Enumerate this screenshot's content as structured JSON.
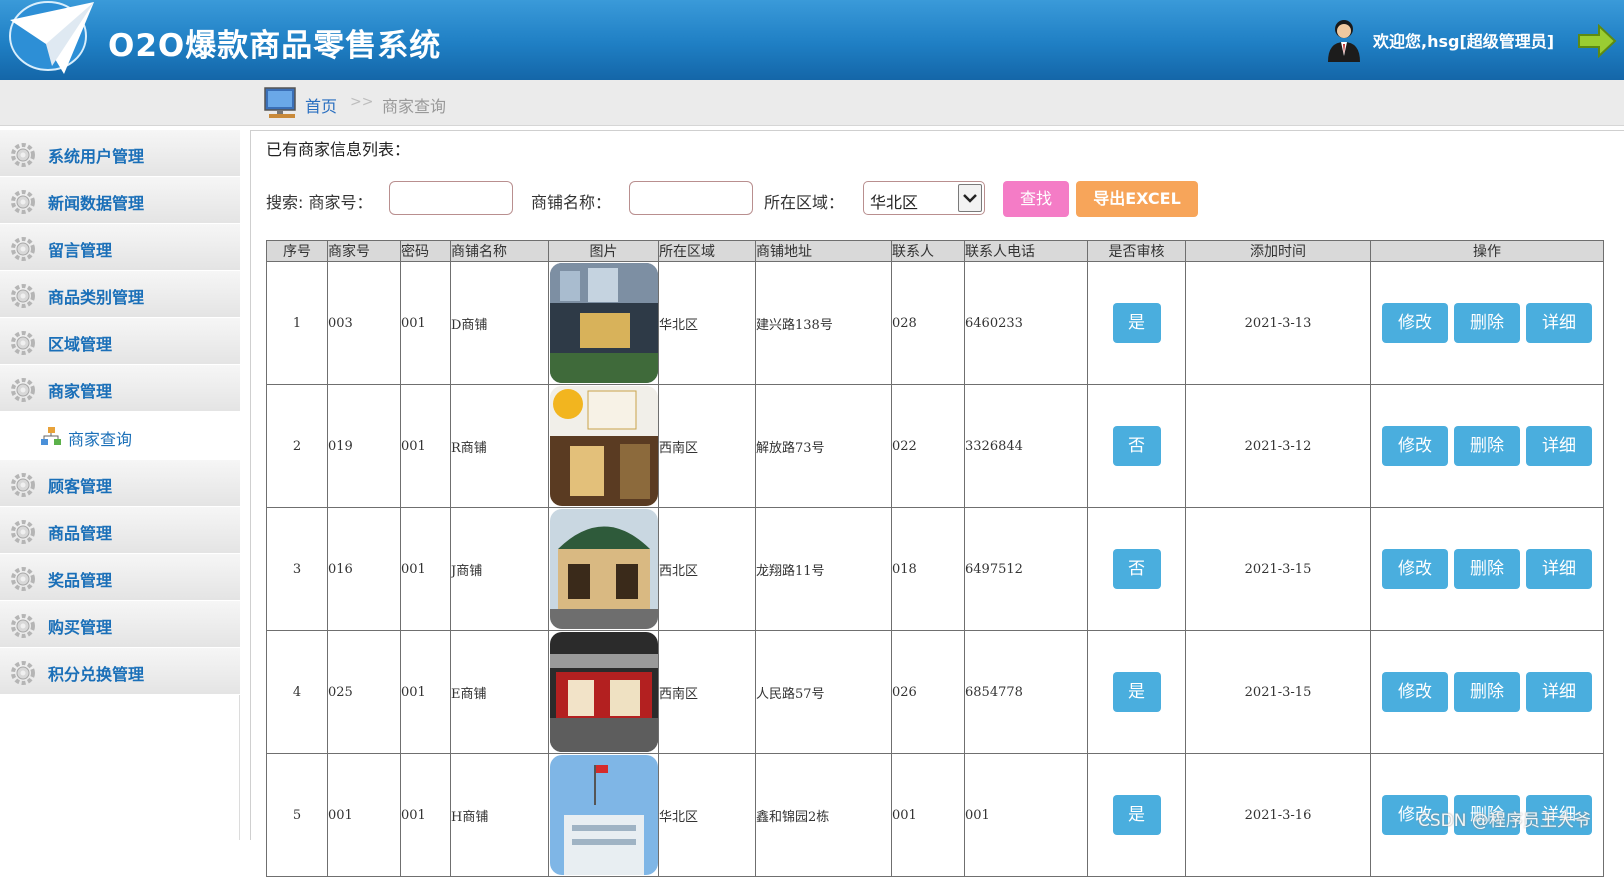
{
  "header": {
    "title": "O2O爆款商品零售系统",
    "welcome": "欢迎您,hsg[超级管理员]"
  },
  "breadcrumb": {
    "home": "首页",
    "separator": ">>",
    "current": "商家查询"
  },
  "sidebar": {
    "items": [
      {
        "label": "系统用户管理"
      },
      {
        "label": "新闻数据管理"
      },
      {
        "label": "留言管理"
      },
      {
        "label": "商品类别管理"
      },
      {
        "label": "区域管理"
      },
      {
        "label": "商家管理"
      },
      {
        "label": "顾客管理"
      },
      {
        "label": "商品管理"
      },
      {
        "label": "奖品管理"
      },
      {
        "label": "购买管理"
      },
      {
        "label": "积分兑换管理"
      }
    ],
    "sub_item": "商家查询"
  },
  "main": {
    "list_title": "已有商家信息列表：",
    "search_label": "搜索: 商家号：",
    "shop_name_label": "商铺名称：",
    "region_label": "所在区域：",
    "merchant_no_value": "",
    "shop_name_value": "",
    "region_value": "华北区",
    "search_button": "查找",
    "export_button": "导出EXCEL"
  },
  "table": {
    "columns": [
      "序号",
      "商家号",
      "密码",
      "商铺名称",
      "图片",
      "所在区域",
      "商铺地址",
      "联系人",
      "联系人电话",
      "是否审核",
      "添加时间",
      "操作"
    ],
    "op_labels": {
      "edit": "修改",
      "delete": "删除",
      "detail": "详细"
    },
    "rows": [
      {
        "no": "1",
        "merchant": "003",
        "password": "001",
        "shop": "D商铺",
        "region": "华北区",
        "address": "建兴路138号",
        "contact": "028",
        "phone": "6460233",
        "audited": "是",
        "added": "2021-3-13"
      },
      {
        "no": "2",
        "merchant": "019",
        "password": "001",
        "shop": "R商铺",
        "region": "西南区",
        "address": "解放路73号",
        "contact": "022",
        "phone": "3326844",
        "audited": "否",
        "added": "2021-3-12"
      },
      {
        "no": "3",
        "merchant": "016",
        "password": "001",
        "shop": "J商铺",
        "region": "西北区",
        "address": "龙翔路11号",
        "contact": "018",
        "phone": "6497512",
        "audited": "否",
        "added": "2021-3-15"
      },
      {
        "no": "4",
        "merchant": "025",
        "password": "001",
        "shop": "E商铺",
        "region": "西南区",
        "address": "人民路57号",
        "contact": "026",
        "phone": "6854778",
        "audited": "是",
        "added": "2021-3-15"
      },
      {
        "no": "5",
        "merchant": "001",
        "password": "001",
        "shop": "H商铺",
        "region": "华北区",
        "address": "鑫和锦园2栋",
        "contact": "001",
        "phone": "001",
        "audited": "是",
        "added": "2021-3-16"
      }
    ]
  },
  "watermark": "CSDN @程序员王大爷",
  "colors": {
    "header": "#1f7fc4",
    "nav_text": "#1a6fb8",
    "search_button": "#f47cc6",
    "export_button": "#f7a55a",
    "action_button": "#4aaede"
  },
  "icons": {
    "logo": "paper-plane-logo",
    "user": "user-avatar-icon",
    "logout": "arrow-right-icon",
    "breadcrumb": "computer-icon",
    "nav": "gear-icon",
    "sub_nav": "tree-icon"
  }
}
